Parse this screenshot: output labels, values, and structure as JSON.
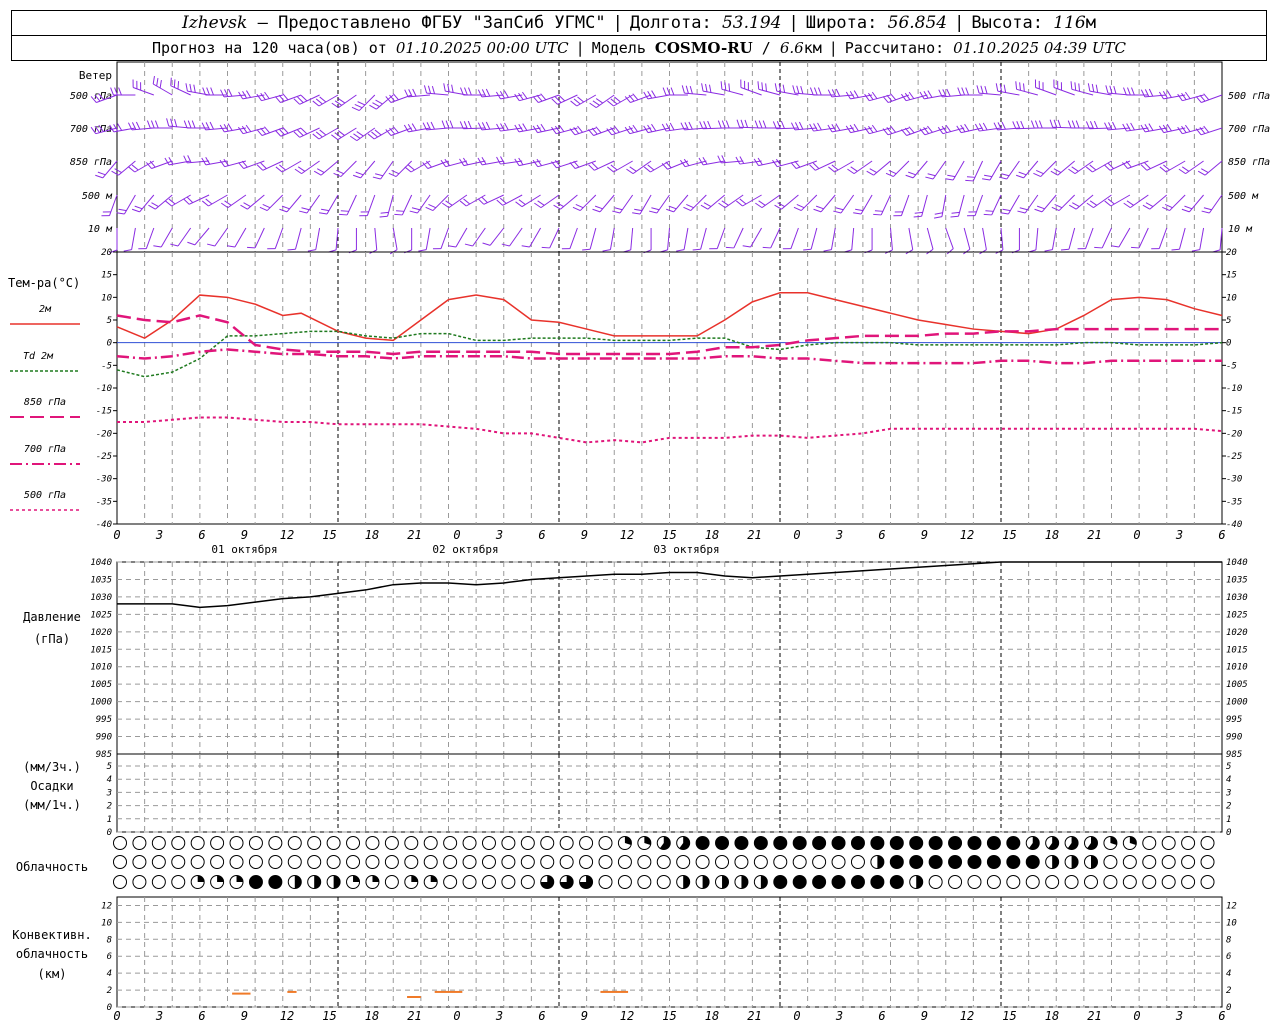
{
  "header": {
    "station": "Izhevsk",
    "dash": "–",
    "provider": "Предоставлено ФГБУ \"ЗапСиб УГМС\"",
    "lon_label": "Долгота:",
    "lon_value": "53.194",
    "lat_label": "Широта:",
    "lat_value": "56.854",
    "alt_label": "Высота:",
    "alt_value": "116",
    "alt_unit": "м",
    "forecast_prefix": "Прогноз на 120 часа(ов) от",
    "forecast_start": "01.10.2025 00:00 UTC",
    "model_label": "Модель",
    "model_name": "COSMO-RU",
    "model_res": "6.6",
    "model_res_unit": "км",
    "calc_label": "Рассчитано:",
    "calc_time": "01.10.2025 04:39 UTC"
  },
  "colors": {
    "wind": "#8a2be2",
    "t2m": "#e8322b",
    "td2m": "#1f7a1f",
    "t850": "#e0157a",
    "t700": "#e0157a",
    "t500": "#e0157a",
    "zero_line": "#2f4fd6",
    "grid": "#9a9a9a",
    "convective": "#f07a28"
  },
  "x_axis": {
    "tick_labels": [
      "0",
      "3",
      "6",
      "9",
      "12",
      "15",
      "18",
      "21",
      "0",
      "3",
      "6",
      "9",
      "12",
      "15",
      "18",
      "21",
      "0",
      "3",
      "6",
      "9",
      "12",
      "15",
      "18",
      "21",
      "0",
      "3",
      "6"
    ],
    "day_labels": [
      "01 октября",
      "02 октября",
      "03 октября"
    ]
  },
  "wind_panel": {
    "title": "Ветер",
    "levels": [
      "500 гПа",
      "700 гПа",
      "850 гПа",
      "500 м",
      "10 м"
    ],
    "right_levels": [
      "500 гПа",
      "700 гПа",
      "850 гПа",
      "500 м",
      "10 м"
    ]
  },
  "temp_panel": {
    "title": "Тем-ра(°C)",
    "legend": [
      "2м",
      "Td 2м",
      "850 гПа",
      "700 гПа",
      "500 гПа"
    ],
    "y_ticks": [
      "20",
      "15",
      "10",
      "5",
      "0",
      "-5",
      "-10",
      "-15",
      "-20",
      "-25",
      "-30",
      "-35",
      "-40"
    ]
  },
  "pressure_panel": {
    "title": "Давление",
    "unit": "(гПа)",
    "y_ticks": [
      "1040",
      "1035",
      "1030",
      "1025",
      "1020",
      "1015",
      "1010",
      "1005",
      "1000",
      "995",
      "990",
      "985"
    ]
  },
  "precip_panel": {
    "unit_top": "(мм/3ч.)",
    "title": "Осадки",
    "unit_bottom": "(мм/1ч.)",
    "y_ticks": [
      "5",
      "4",
      "3",
      "2",
      "1",
      "0"
    ]
  },
  "cloud_panel": {
    "title": "Облачность"
  },
  "convective_panel": {
    "title_line1": "Конвективн.",
    "title_line2": "облачность",
    "title_line3": "(км)",
    "y_ticks": [
      "12",
      "10",
      "8",
      "6",
      "4",
      "2",
      "0"
    ]
  },
  "chart_data": [
    {
      "type": "line",
      "title": "Тем-ра(°C)",
      "x_unit": "hours since 01.10.2025 00:00 UTC",
      "ylim": [
        -40,
        20
      ],
      "grid": true,
      "series": [
        {
          "name": "2м",
          "x": [
            0,
            3,
            6,
            9,
            12,
            15,
            18,
            20,
            24,
            27,
            30,
            33,
            36,
            39,
            42,
            45,
            48,
            51,
            54,
            57,
            60,
            63,
            66,
            69,
            72,
            75,
            78,
            81,
            84,
            87,
            90,
            93,
            96,
            99,
            102,
            105,
            108,
            111,
            114,
            117,
            120
          ],
          "values": [
            3.5,
            1,
            5,
            10.5,
            10,
            8.5,
            6,
            6.5,
            2.5,
            1,
            0.5,
            5,
            9.5,
            10.5,
            9.5,
            5,
            4.5,
            3,
            1.5,
            1.5,
            1.5,
            1.5,
            5,
            9,
            11,
            11,
            9.5,
            8,
            6.5,
            5,
            4,
            3,
            2.5,
            2,
            3,
            6,
            9.5,
            10,
            9.5,
            7.5,
            6
          ]
        },
        {
          "name": "Td 2м",
          "x": [
            0,
            3,
            6,
            9,
            12,
            15,
            18,
            21,
            24,
            27,
            30,
            33,
            36,
            39,
            42,
            45,
            48,
            51,
            54,
            57,
            60,
            63,
            66,
            69,
            72,
            75,
            78,
            81,
            84,
            87,
            90,
            93,
            96,
            99,
            102,
            105,
            108,
            111,
            114,
            117,
            120
          ],
          "values": [
            -6,
            -7.5,
            -6.5,
            -3.5,
            1.5,
            1.5,
            2,
            2.5,
            2.5,
            1.5,
            1,
            2,
            2,
            0.5,
            0.5,
            1,
            1,
            1,
            0.5,
            0.5,
            0.5,
            1,
            1,
            -1,
            -1.5,
            -0.5,
            0,
            0,
            0,
            -0.5,
            -0.5,
            -0.5,
            -0.5,
            -0.5,
            -0.5,
            0,
            0,
            -0.5,
            -0.5,
            -0.5,
            0
          ]
        },
        {
          "name": "850 гПа",
          "x": [
            0,
            3,
            6,
            9,
            12,
            15,
            18,
            21,
            24,
            27,
            30,
            33,
            36,
            39,
            42,
            45,
            48,
            51,
            54,
            57,
            60,
            63,
            66,
            69,
            72,
            75,
            78,
            81,
            84,
            87,
            90,
            93,
            96,
            99,
            102,
            105,
            108,
            111,
            114,
            117,
            120
          ],
          "values": [
            6,
            5,
            4.5,
            6,
            4.5,
            -0.5,
            -1.5,
            -2,
            -2,
            -2,
            -2.5,
            -2,
            -2,
            -2,
            -2,
            -2,
            -2.5,
            -2.5,
            -2.5,
            -2.5,
            -2.5,
            -2,
            -1,
            -1,
            -0.5,
            0.5,
            1,
            1.5,
            1.5,
            1.5,
            2,
            2,
            2.5,
            2.5,
            3,
            3,
            3,
            3,
            3,
            3,
            3
          ]
        },
        {
          "name": "700 гПа",
          "x": [
            0,
            3,
            6,
            9,
            12,
            15,
            18,
            21,
            24,
            27,
            30,
            33,
            36,
            39,
            42,
            45,
            48,
            51,
            54,
            57,
            60,
            63,
            66,
            69,
            72,
            75,
            78,
            81,
            84,
            87,
            90,
            93,
            96,
            99,
            102,
            105,
            108,
            111,
            114,
            117,
            120
          ],
          "values": [
            -3,
            -3.5,
            -3,
            -2,
            -1.5,
            -2,
            -2.5,
            -2.5,
            -3,
            -3,
            -3.5,
            -3,
            -3,
            -3,
            -3,
            -3.5,
            -3.5,
            -3.5,
            -3.5,
            -3.5,
            -3.5,
            -3.5,
            -3,
            -3,
            -3.5,
            -3.5,
            -4,
            -4.5,
            -4.5,
            -4.5,
            -4.5,
            -4.5,
            -4,
            -4,
            -4.5,
            -4.5,
            -4,
            -4,
            -4,
            -4,
            -4
          ]
        },
        {
          "name": "500 гПа",
          "x": [
            0,
            3,
            6,
            9,
            12,
            15,
            18,
            21,
            24,
            27,
            30,
            33,
            36,
            39,
            42,
            45,
            48,
            51,
            54,
            57,
            60,
            63,
            66,
            69,
            72,
            75,
            78,
            81,
            84,
            87,
            90,
            93,
            96,
            99,
            102,
            105,
            108,
            111,
            114,
            117,
            120
          ],
          "values": [
            -17.5,
            -17.5,
            -17,
            -16.5,
            -16.5,
            -17,
            -17.5,
            -17.5,
            -18,
            -18,
            -18,
            -18,
            -18.5,
            -19,
            -20,
            -20,
            -21,
            -22,
            -21.5,
            -22,
            -21,
            -21,
            -21,
            -20.5,
            -20.5,
            -21,
            -20.5,
            -20,
            -19,
            -19,
            -19,
            -19,
            -19,
            -19,
            -19,
            -19,
            -19,
            -19,
            -19,
            -19,
            -19.5
          ]
        }
      ]
    },
    {
      "type": "line",
      "title": "Давление",
      "x_unit": "hours since 01.10.2025 00:00 UTC",
      "ylim": [
        985,
        1040
      ],
      "grid": true,
      "series": [
        {
          "x": [
            0,
            3,
            6,
            9,
            12,
            15,
            18,
            21,
            24,
            27,
            30,
            33,
            36,
            39,
            42,
            45,
            48,
            51,
            54,
            57,
            60,
            63,
            66,
            69,
            72,
            75,
            78,
            81,
            84,
            87,
            90,
            93,
            96,
            99,
            102,
            105,
            108,
            111,
            114,
            117,
            120
          ],
          "values": [
            1028,
            1028,
            1028,
            1027,
            1027.5,
            1028.5,
            1029.5,
            1030,
            1031,
            1032,
            1033.5,
            1034,
            1034,
            1033.5,
            1034,
            1035,
            1035.5,
            1036,
            1036.5,
            1036.5,
            1037,
            1037,
            1036,
            1035.5,
            1036,
            1036.5,
            1037,
            1037.5,
            1038,
            1038.5,
            1039,
            1039.5,
            1040,
            1040,
            1040,
            1040,
            1040,
            1040,
            1040,
            1040,
            1040
          ]
        }
      ]
    },
    {
      "type": "bar",
      "title": "Конвективн. облачность (км)",
      "x_unit": "hours since 01.10.2025 00:00 UTC",
      "ylim": [
        0,
        13
      ],
      "bars": [
        {
          "from": 12.5,
          "to": 14.5,
          "base_km": 1.5,
          "top_km": 1.7
        },
        {
          "from": 18.5,
          "to": 19.5,
          "base_km": 1.7,
          "top_km": 1.9
        },
        {
          "from": 31.5,
          "to": 33,
          "base_km": 1.1,
          "top_km": 1.3
        },
        {
          "from": 34.5,
          "to": 37.5,
          "base_km": 1.7,
          "top_km": 1.9
        },
        {
          "from": 52.5,
          "to": 55.5,
          "base_km": 1.7,
          "top_km": 1.9
        }
      ]
    }
  ]
}
